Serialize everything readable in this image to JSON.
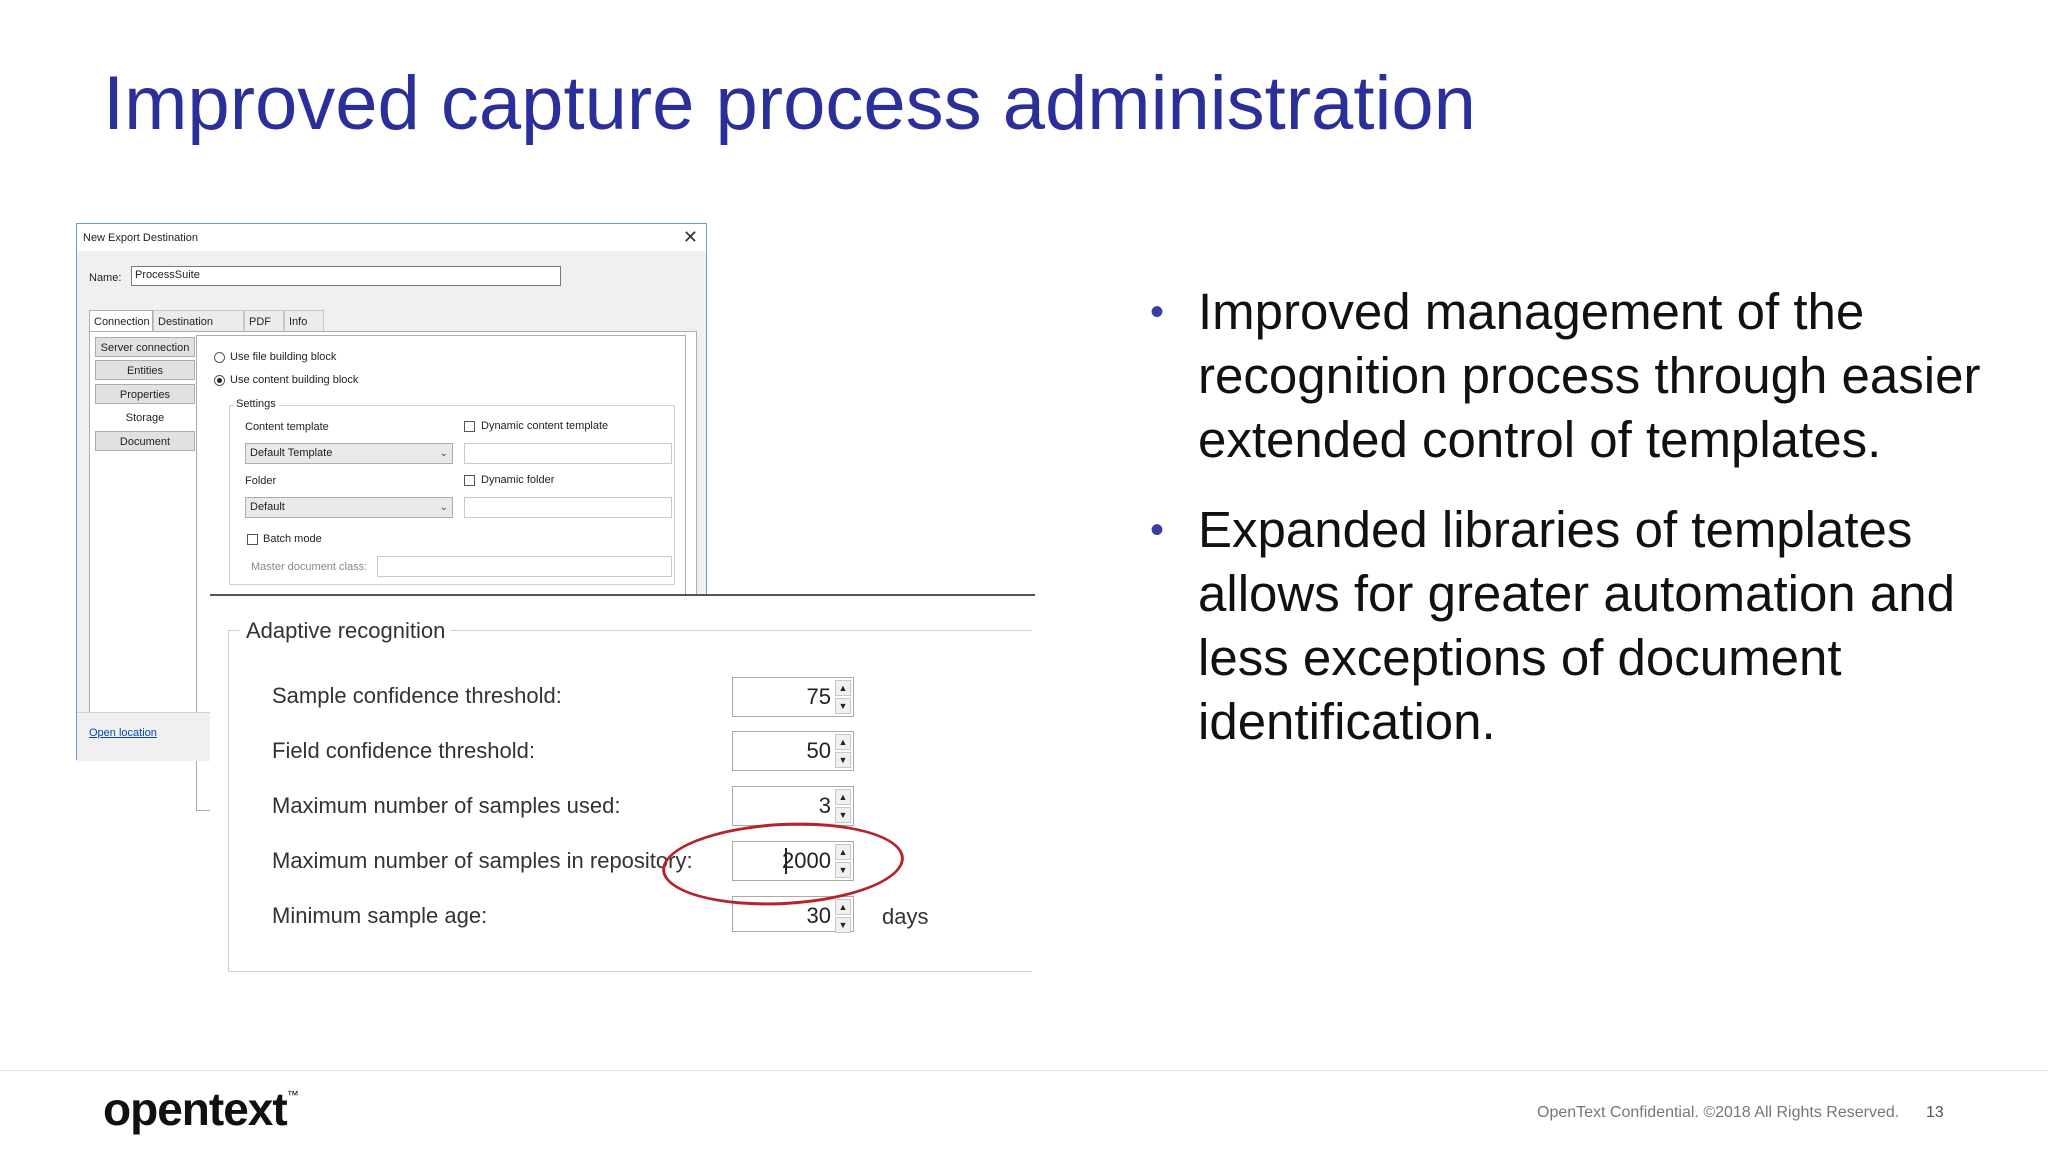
{
  "slide": {
    "title": "Improved capture process administration"
  },
  "dialog": {
    "title": "New Export Destination",
    "name_label": "Name:",
    "name_value": "ProcessSuite",
    "tabs": [
      "Connection",
      "Destination fields",
      "PDF",
      "Info"
    ],
    "side_buttons": [
      "Server connection",
      "Entities",
      "Properties",
      "Storage",
      "Document"
    ],
    "radio_file": "Use file building block",
    "radio_content": "Use content building block",
    "settings_label": "Settings",
    "content_template_label": "Content template",
    "dynamic_content_template_label": "Dynamic content template",
    "content_template_value": "Default Template",
    "folder_label": "Folder",
    "dynamic_folder_label": "Dynamic folder",
    "folder_value": "Default",
    "batch_mode_label": "Batch mode",
    "master_doc_label": "Master document class:",
    "open_location": "Open location"
  },
  "adaptive": {
    "legend": "Adaptive recognition",
    "rows": [
      {
        "label": "Sample confidence threshold:",
        "value": "75"
      },
      {
        "label": "Field confidence threshold:",
        "value": "50"
      },
      {
        "label": "Maximum number of samples used:",
        "value": "3"
      },
      {
        "label": "Maximum number of samples in repository:",
        "value": "2000"
      },
      {
        "label": "Minimum sample age:",
        "value": "30",
        "unit": "days"
      }
    ]
  },
  "bullets": [
    "Improved management of the recognition process through easier extended control of templates.",
    "Expanded libraries of templates allows for greater automation and less exceptions of document identification."
  ],
  "footer": {
    "logo": "opentext",
    "trademark": "™",
    "copyright": "OpenText Confidential. ©2018 All Rights Reserved.",
    "page": "13"
  }
}
